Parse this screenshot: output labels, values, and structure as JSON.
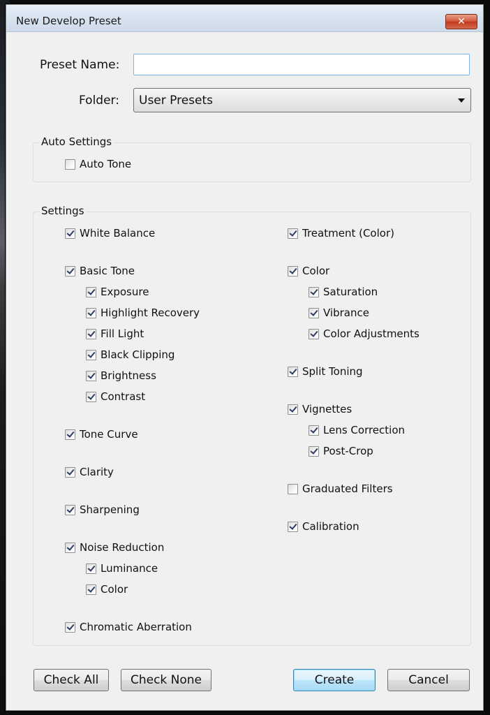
{
  "window": {
    "title": "New Develop Preset",
    "close_label": "✕"
  },
  "form": {
    "preset_name_label": "Preset Name:",
    "preset_name_value": "",
    "folder_label": "Folder:",
    "folder_value": "User Presets"
  },
  "auto_settings": {
    "title": "Auto Settings",
    "items": [
      {
        "label": "Auto Tone",
        "checked": false
      }
    ]
  },
  "settings": {
    "title": "Settings",
    "left": [
      {
        "label": "White Balance",
        "checked": true
      },
      {
        "label": "Basic Tone",
        "checked": true
      },
      {
        "label": "Exposure",
        "checked": true
      },
      {
        "label": "Highlight Recovery",
        "checked": true
      },
      {
        "label": "Fill Light",
        "checked": true
      },
      {
        "label": "Black Clipping",
        "checked": true
      },
      {
        "label": "Brightness",
        "checked": true
      },
      {
        "label": "Contrast",
        "checked": true
      },
      {
        "label": "Tone Curve",
        "checked": true
      },
      {
        "label": "Clarity",
        "checked": true
      },
      {
        "label": "Sharpening",
        "checked": true
      },
      {
        "label": "Noise Reduction",
        "checked": true
      },
      {
        "label": "Luminance",
        "checked": true
      },
      {
        "label": "Color",
        "checked": true
      },
      {
        "label": "Chromatic Aberration",
        "checked": true
      }
    ],
    "right": [
      {
        "label": "Treatment (Color)",
        "checked": true
      },
      {
        "label": "Color",
        "checked": true
      },
      {
        "label": "Saturation",
        "checked": true
      },
      {
        "label": "Vibrance",
        "checked": true
      },
      {
        "label": "Color Adjustments",
        "checked": true
      },
      {
        "label": "Split Toning",
        "checked": true
      },
      {
        "label": "Vignettes",
        "checked": true
      },
      {
        "label": "Lens Correction",
        "checked": true
      },
      {
        "label": "Post-Crop",
        "checked": true
      },
      {
        "label": "Graduated Filters",
        "checked": false
      },
      {
        "label": "Calibration",
        "checked": true
      }
    ]
  },
  "buttons": {
    "check_all": "Check All",
    "check_none": "Check None",
    "create": "Create",
    "cancel": "Cancel"
  }
}
